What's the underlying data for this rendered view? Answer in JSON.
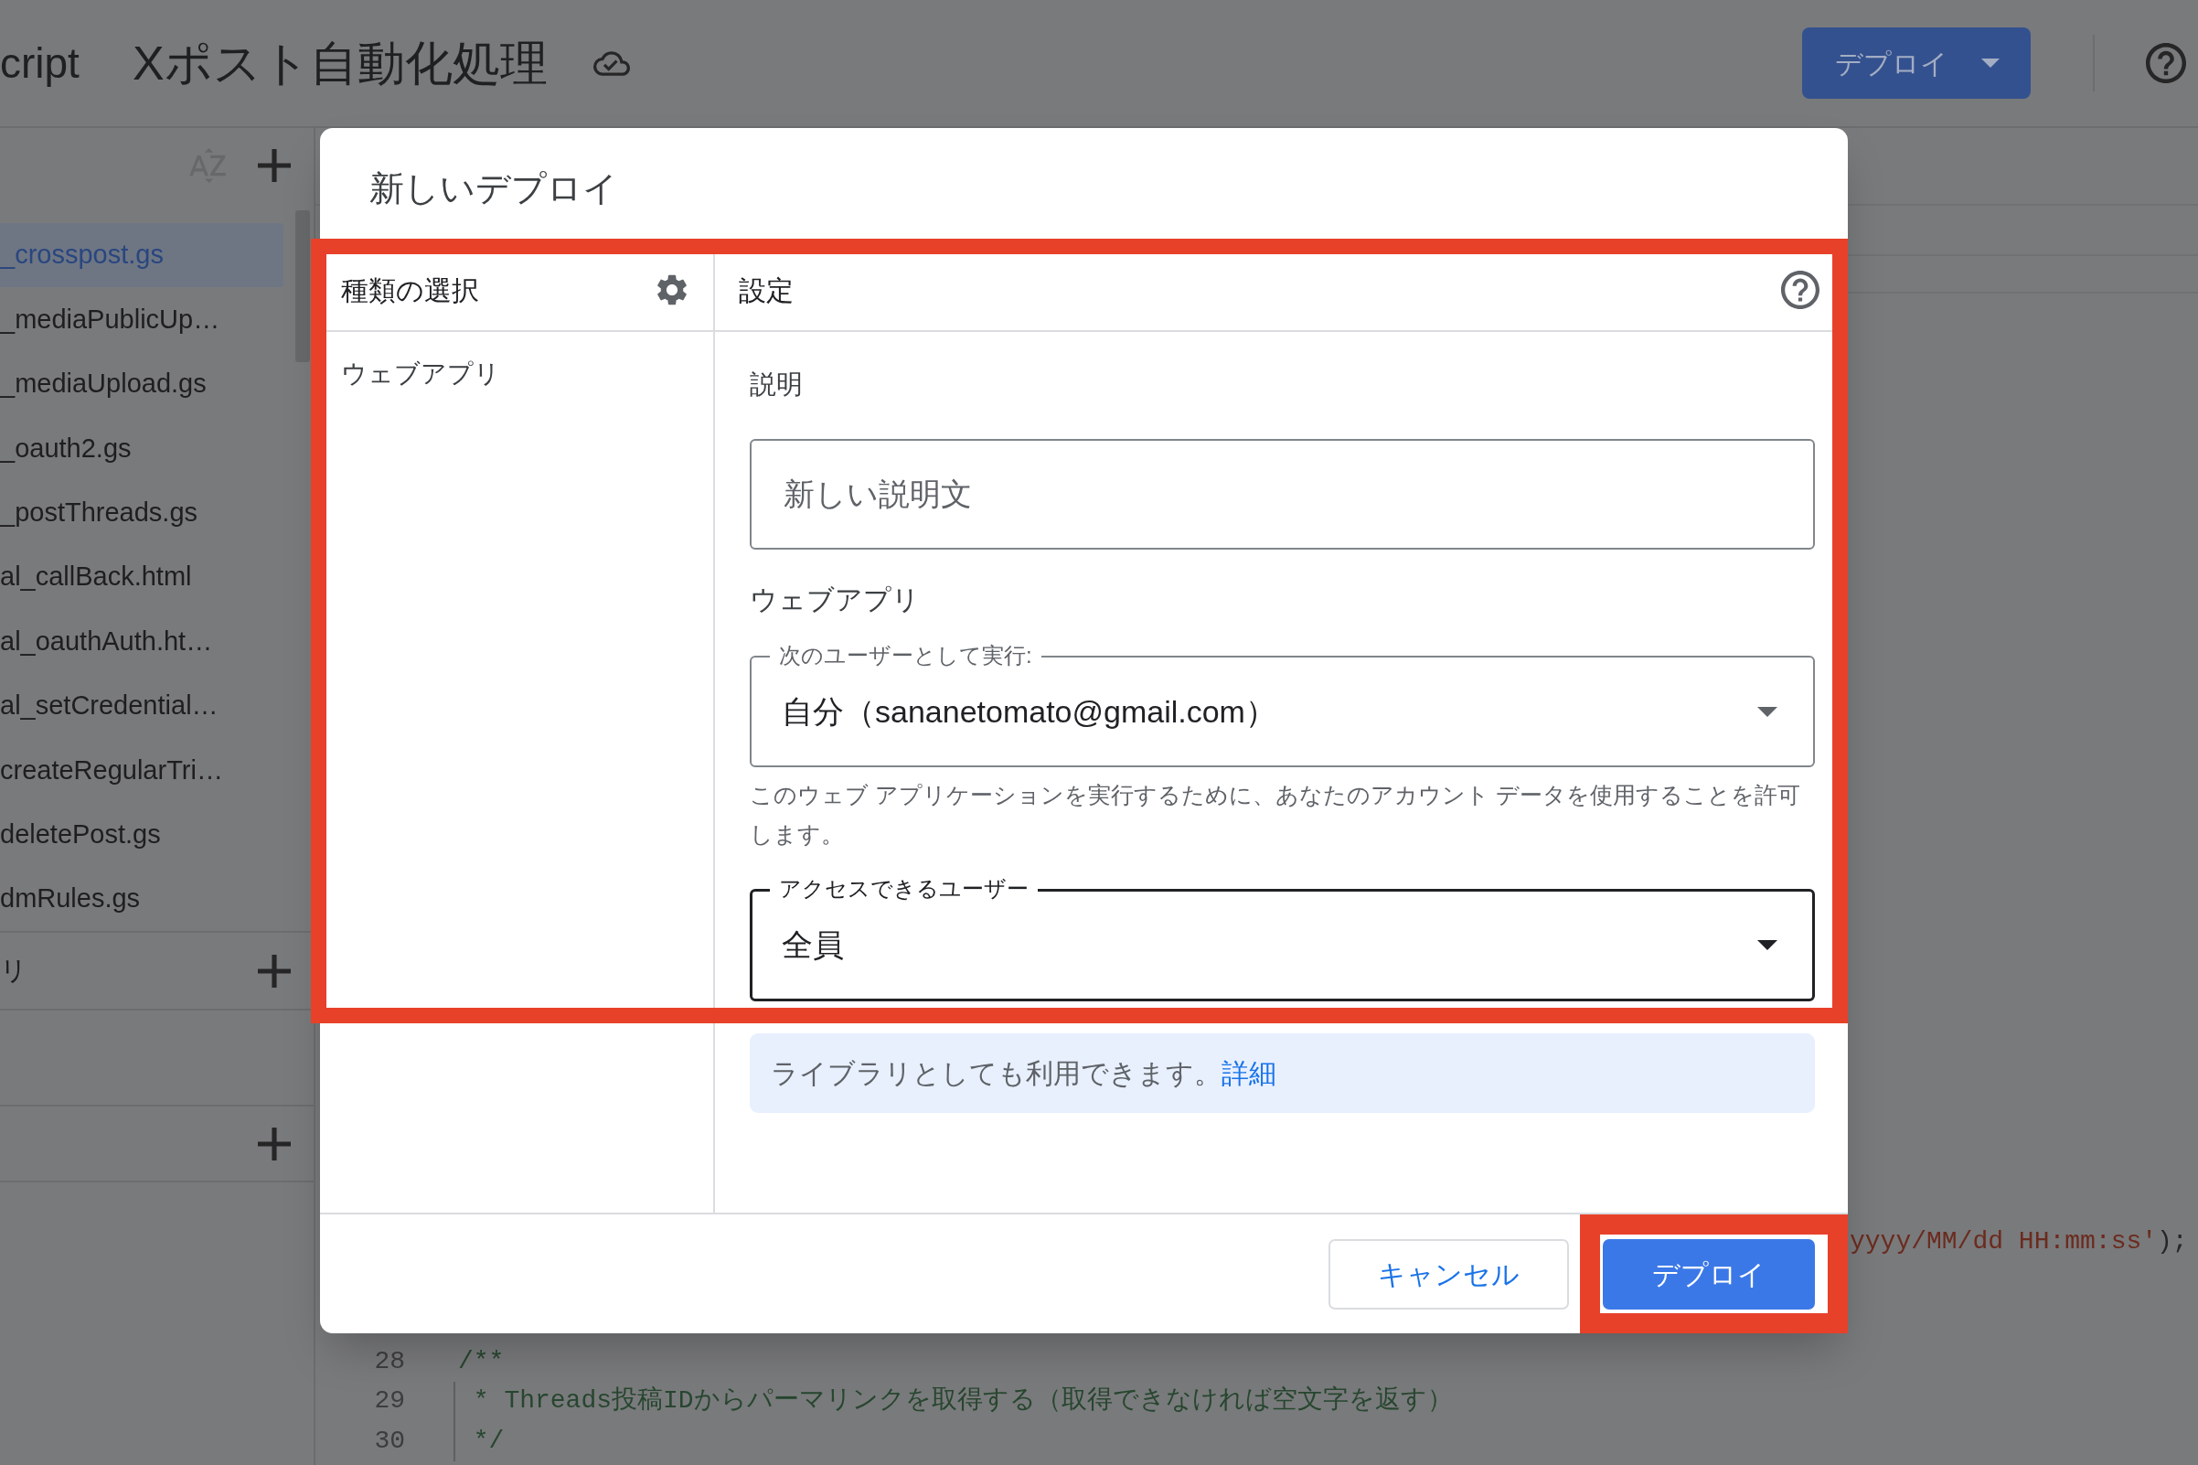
{
  "top_bar": {
    "product_name": "cript",
    "project_title": "Xポスト自動化処理",
    "deploy_button": "デプロイ"
  },
  "sidebar": {
    "files": [
      {
        "name": "_crosspost.gs",
        "selected": true
      },
      {
        "name": "_mediaPublicUp…",
        "selected": false
      },
      {
        "name": "_mediaUpload.gs",
        "selected": false
      },
      {
        "name": "_oauth2.gs",
        "selected": false
      },
      {
        "name": "_postThreads.gs",
        "selected": false
      },
      {
        "name": "al_callBack.html",
        "selected": false
      },
      {
        "name": "al_oauthAuth.ht…",
        "selected": false
      },
      {
        "name": "al_setCredential…",
        "selected": false
      },
      {
        "name": "createRegularTri…",
        "selected": false
      },
      {
        "name": "deletePost.gs",
        "selected": false
      },
      {
        "name": "dmRules.gs",
        "selected": false
      }
    ],
    "sections": [
      {
        "title": "リ",
        "add_button": true
      },
      {
        "add_button": true
      }
    ]
  },
  "editor": {
    "partial_line": [
      {
        "kind": "string",
        "text": "yyyy/MM/dd HH:mm:ss'"
      },
      {
        "kind": "plain",
        "text": ");"
      }
    ],
    "lines": [
      {
        "number": "28",
        "code": "/**",
        "indent_guide": false
      },
      {
        "number": "29",
        "code": " * Threads投稿IDからパーマリンクを取得する（取得できなければ空文字を返す）",
        "indent_guide": true
      },
      {
        "number": "30",
        "code": " */",
        "indent_guide": true
      }
    ]
  },
  "dialog": {
    "title": "新しいデプロイ",
    "type_panel": {
      "heading": "種類の選択",
      "types": [
        "ウェブアプリ"
      ]
    },
    "settings": {
      "heading": "設定",
      "description": {
        "label": "説明",
        "placeholder": "新しい説明文"
      },
      "section_title": "ウェブアプリ",
      "execute_as": {
        "label": "次のユーザーとして実行:",
        "value": "自分（sananetomato@gmail.com）",
        "focused": false
      },
      "execute_as_hint": "このウェブ アプリケーションを実行するために、あなたのアカウント データを使用することを許可します。",
      "access": {
        "label": "アクセスできるユーザー",
        "value": "全員",
        "focused": true
      },
      "info": {
        "text": "ライブラリとしても利用できます。",
        "link": "詳細"
      }
    },
    "buttons": [
      {
        "label": "キャンセル",
        "kind": "secondary"
      },
      {
        "label": "デプロイ",
        "kind": "primary"
      }
    ],
    "highlights": {
      "settings_area": true,
      "deploy_button": true
    }
  }
}
